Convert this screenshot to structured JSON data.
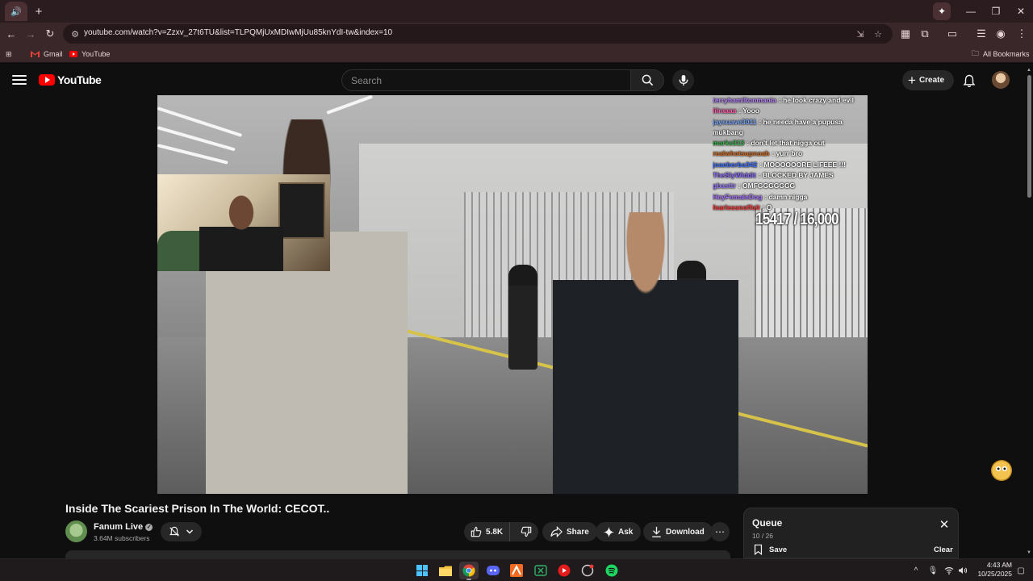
{
  "browser": {
    "tab_icon": "audio-tab-icon",
    "new_tab": "+",
    "url": "youtube.com/watch?v=Zzxv_27t6TU&list=TLPQMjUxMDIwMjUu85knYdI-tw&index=10",
    "bookmarks": [
      {
        "label": "Gmail",
        "icon": "gmail-icon"
      },
      {
        "label": "YouTube",
        "icon": "youtube-icon"
      }
    ],
    "all_bookmarks": "All Bookmarks"
  },
  "masthead": {
    "logo_text": "YouTube",
    "search_placeholder": "Search",
    "create_label": "Create"
  },
  "video": {
    "chat": [
      {
        "user": "terryhamiltonmania",
        "user_color": "#b884ff",
        "text": ": he look crazy and evil"
      },
      {
        "user": "lilraaaa",
        "user_color": "#ff5fae",
        "text": ": Yooo"
      },
      {
        "user": "jaysuave3011",
        "user_color": "#7aa7ff",
        "text": ": he needa have a pupusa mukbang"
      },
      {
        "user": "marks313",
        "user_color": "#39b54a",
        "text": ": don't let that nigga out"
      },
      {
        "user": "realwhotsupnoah",
        "user_color": "#d2691e",
        "text": ": yurr bro"
      },
      {
        "user": "joaoborba342",
        "user_color": "#3b6fff",
        "text": ": MOOOOOORE LIFEEE !!!"
      },
      {
        "user": "TheSlyWiddit",
        "user_color": "#8a6bff",
        "text": ": BLOCKED BY JAMES"
      },
      {
        "user": "gbasttr",
        "user_color": "#9e7dff",
        "text": ": OMFGGGGGGG"
      },
      {
        "user": "HeyFemaleDog",
        "user_color": "#a974ff",
        "text": ": damn nigga"
      },
      {
        "user": "fearlessnoffoit",
        "user_color": "#ff3b3b",
        "text": ": O"
      }
    ],
    "goal_counter": "15417 / 16,000"
  },
  "watch": {
    "title": "Inside The Scariest Prison In The World: CECOT..",
    "channel_name": "Fanum Live",
    "subscribers": "3.64M subscribers",
    "likes": "5.8K",
    "share_label": "Share",
    "ask_label": "Ask",
    "download_label": "Download"
  },
  "queue": {
    "title": "Queue",
    "count": "10 / 26",
    "save_label": "Save",
    "clear_label": "Clear"
  },
  "taskbar": {
    "time": "4:43 AM",
    "date": "10/25/2025"
  },
  "colors": {
    "accent_red": "#ff0000",
    "browser_frame": "#3a272a",
    "yt_background": "#0f0f0f"
  }
}
